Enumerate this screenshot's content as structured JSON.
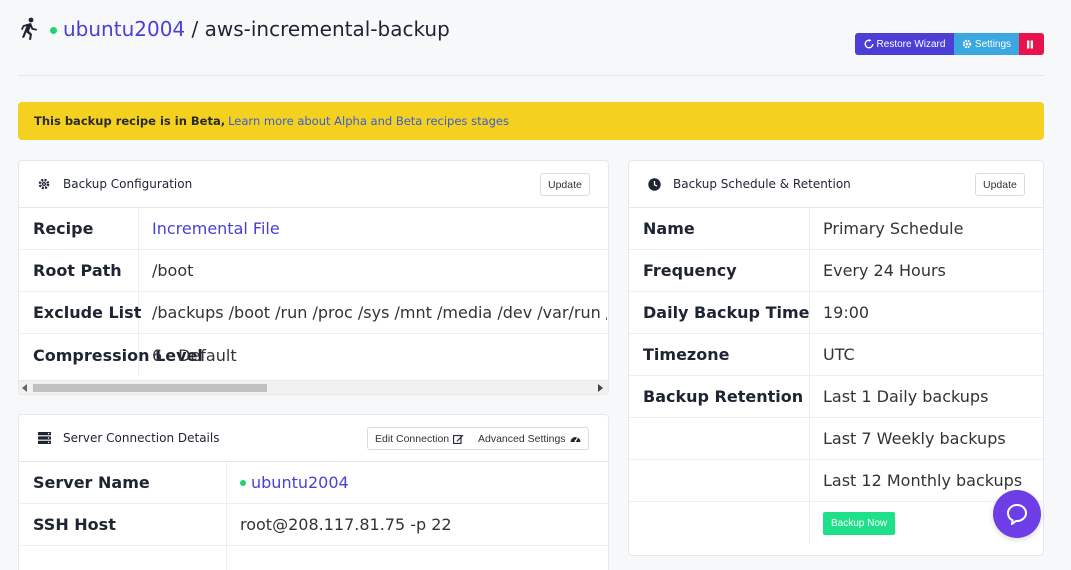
{
  "header": {
    "server_name": "ubuntu2004",
    "separator": "/",
    "backup_name": "aws-incremental-backup",
    "restore_label": "Restore Wizard",
    "settings_label": "Settings"
  },
  "banner": {
    "text": "This backup recipe is in Beta,",
    "link": "Learn more about Alpha and Beta recipes stages"
  },
  "config": {
    "title": "Backup Configuration",
    "update_label": "Update",
    "rows": [
      {
        "key": "Recipe",
        "value": "Incremental File"
      },
      {
        "key": "Root Path",
        "value": "/boot"
      },
      {
        "key": "Exclude List",
        "value": "/backups /boot /run /proc /sys /mnt /media /dev /var/run /var/cache /var/tmp /var/lib/apt/li"
      },
      {
        "key": "Compression Level",
        "value": "6 - Default"
      }
    ]
  },
  "connection": {
    "title": "Server Connection Details",
    "edit_label": "Edit Connection",
    "advanced_label": "Advanced Settings",
    "rows": [
      {
        "key": "Server Name",
        "value": "ubuntu2004"
      },
      {
        "key": "SSH Host",
        "value": "root@208.117.81.75 -p 22"
      }
    ]
  },
  "schedule": {
    "title": "Backup Schedule & Retention",
    "update_label": "Update",
    "rows": [
      {
        "key": "Name",
        "value": "Primary Schedule"
      },
      {
        "key": "Frequency",
        "value": "Every 24 Hours"
      },
      {
        "key": "Daily Backup Time",
        "value": "19:00"
      },
      {
        "key": "Timezone",
        "value": "UTC"
      },
      {
        "key": "Backup Retention",
        "value": "Last 1 Daily backups"
      },
      {
        "key": "",
        "value": "Last 7 Weekly backups"
      },
      {
        "key": "",
        "value": "Last 12 Monthly backups"
      }
    ],
    "backup_now_label": "Backup Now"
  },
  "colors": {
    "accent": "#4b3fd6",
    "settings": "#3aa7e0",
    "danger": "#e8134c",
    "banner": "#f4d11e",
    "success": "#1ee08b",
    "chat": "#6d3ee6"
  },
  "icons": [
    "running-person-icon",
    "online-status-dot",
    "restore-icon",
    "gear-icon",
    "pause-icon",
    "clock-icon",
    "server-icon",
    "edit-icon",
    "dashboard-icon",
    "chat-icon"
  ]
}
